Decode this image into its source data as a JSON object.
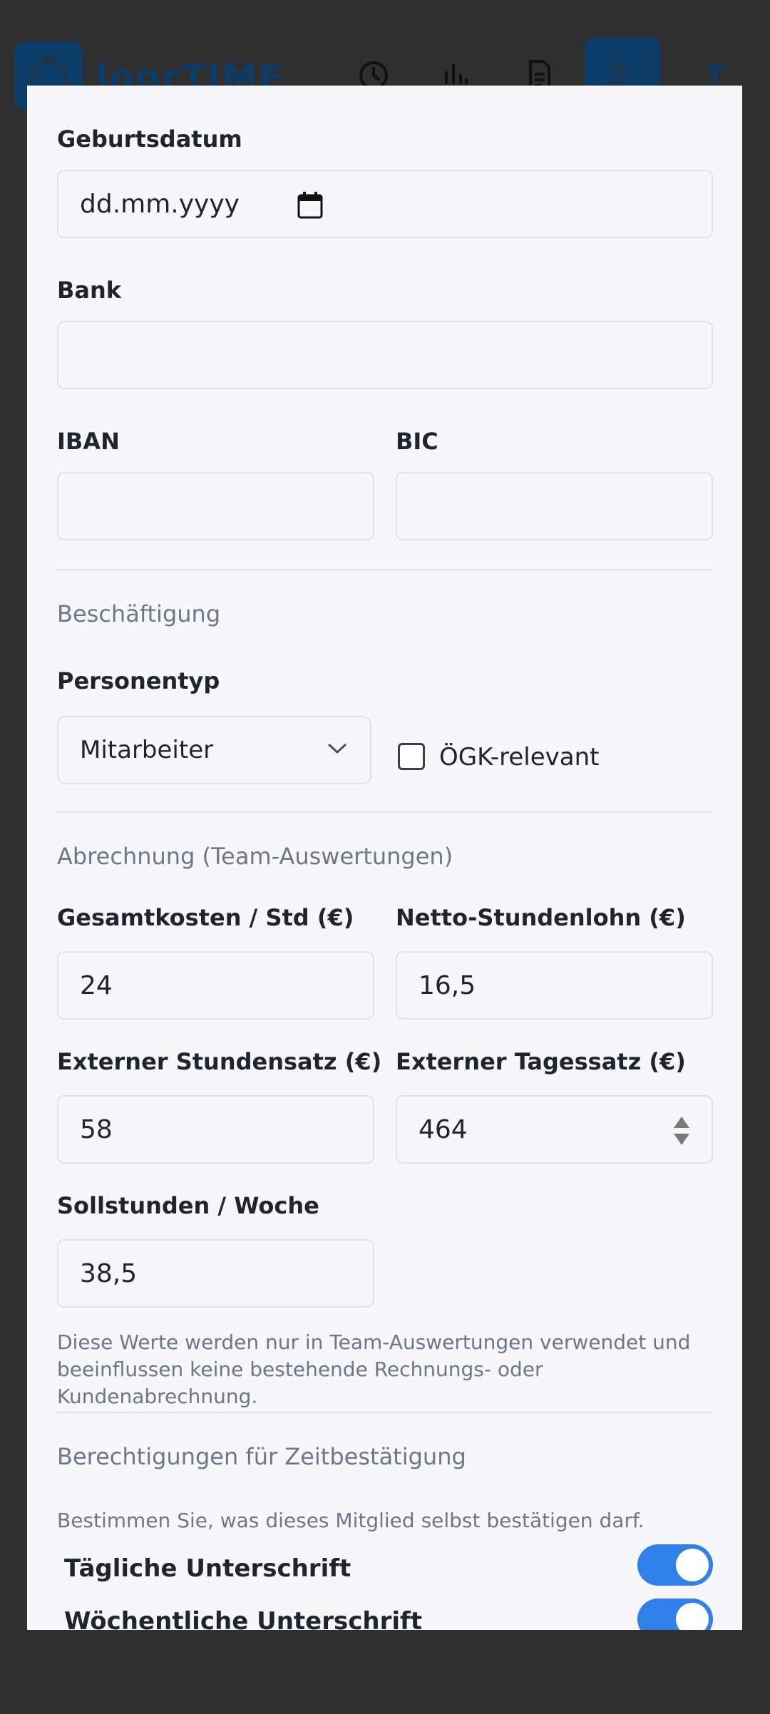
{
  "app": {
    "logo_text": "logrTIME",
    "avatar_initial": "T"
  },
  "form": {
    "birthdate": {
      "label": "Geburtsdatum",
      "value": "dd.mm.yyyy"
    },
    "bank": {
      "label": "Bank",
      "value": ""
    },
    "iban": {
      "label": "IBAN",
      "value": ""
    },
    "bic": {
      "label": "BIC",
      "value": ""
    },
    "employment": {
      "section_title": "Beschäftigung",
      "person_type_label": "Personentyp",
      "person_type_value": "Mitarbeiter",
      "oegk_label": "ÖGK-relevant",
      "oegk_checked": false
    },
    "billing": {
      "section_title": "Abrechnung (Team-Auswertungen)",
      "total_cost_label": "Gesamtkosten / Std (€)",
      "total_cost_value": "24",
      "net_wage_label": "Netto-Stundenlohn (€)",
      "net_wage_value": "16,5",
      "ext_hourly_label": "Externer Stundensatz (€)",
      "ext_hourly_value": "58",
      "ext_daily_label": "Externer Tagessatz (€)",
      "ext_daily_value": "464",
      "target_hours_label": "Sollstunden / Woche",
      "target_hours_value": "38,5",
      "helper_text": "Diese Werte werden nur in Team-Auswertungen verwendet und beeinflussen keine bestehende Rechnungs- oder Kundenabrechnung."
    },
    "permissions": {
      "section_title": "Berechtigungen für Zeitbestätigung",
      "helper_text": "Bestimmen Sie, was dieses Mitglied selbst bestätigen darf.",
      "daily_label": "Tägliche Unterschrift",
      "daily_on": true,
      "weekly_label": "Wöchentliche Unterschrift",
      "weekly_on": true
    }
  },
  "colors": {
    "accent": "#2f80e8",
    "overlay": "#2f2f2f",
    "brand": "#0b3d68"
  },
  "icons": [
    "calendar-icon",
    "chevron-down-icon",
    "spinner-icon",
    "stopwatch-icon",
    "clock-icon",
    "chart-icon",
    "document-icon",
    "users-icon"
  ]
}
